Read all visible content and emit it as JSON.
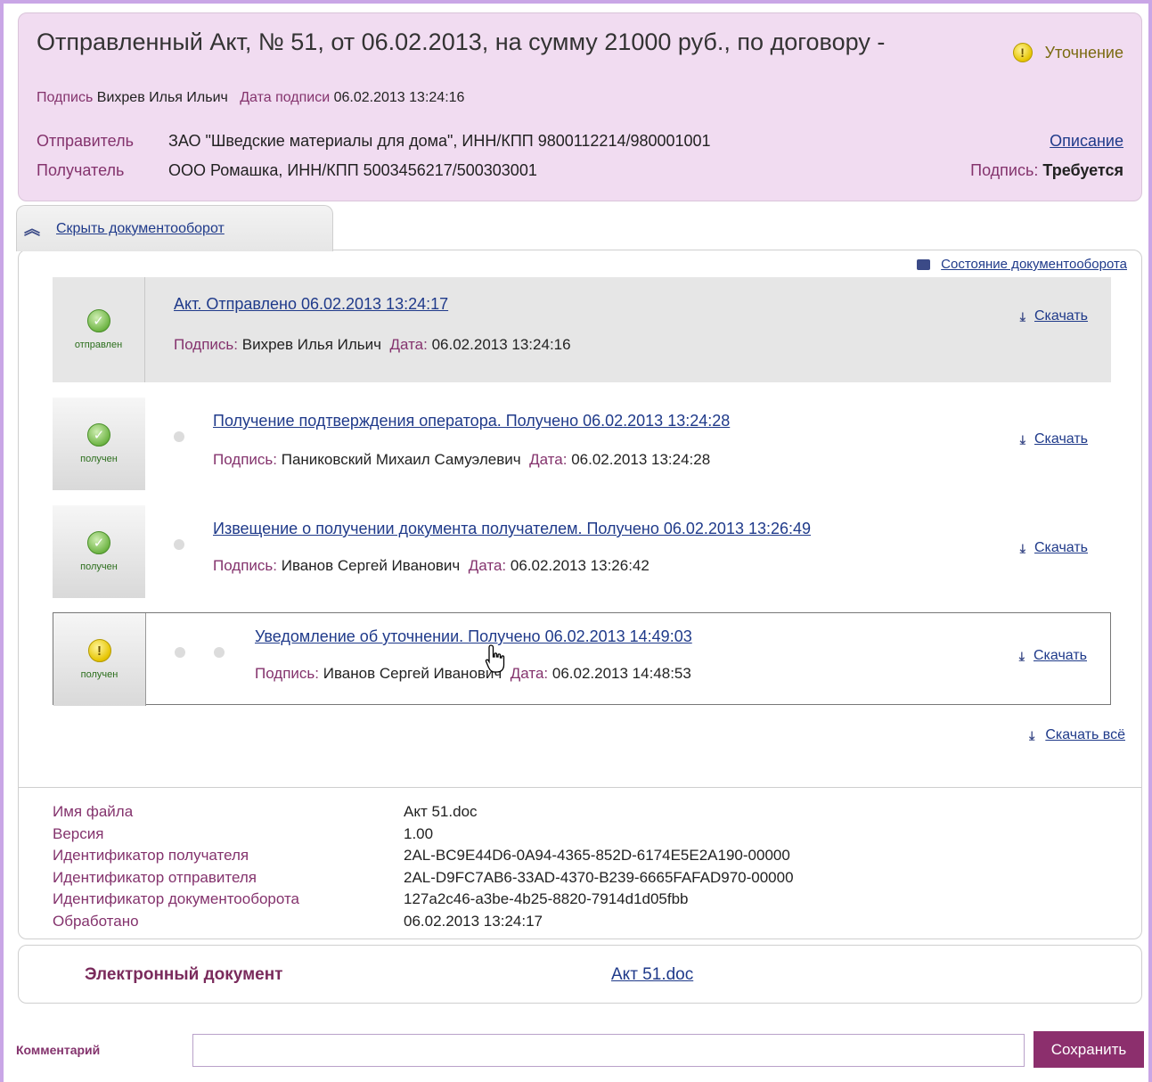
{
  "header": {
    "title": "Отправленный Акт, № 51, от 06.02.2013, на сумму 21000 руб., по договору -",
    "signature_label": "Подпись",
    "signature_value": "Вихрев Илья Ильич",
    "sign_date_label": "Дата подписи",
    "sign_date_value": "06.02.2013 13:24:16",
    "status_text": "Уточнение",
    "sender_label": "Отправитель",
    "sender_value": "ЗАО \"Шведские материалы для дома\", ИНН/КПП 9800112214/980001001",
    "recipient_label": "Получатель",
    "recipient_value": "ООО Ромашка, ИНН/КПП 5003456217/500303001",
    "description_link": "Описание",
    "signature_req_label": "Подпись:",
    "signature_req_value": "Требуется"
  },
  "tab": {
    "label": "Скрыть документооборот"
  },
  "workflow": {
    "state_link": "Состояние документооборота",
    "download_label": "Скачать",
    "download_all_label": "Скачать всё",
    "sig_label": "Подпись:",
    "date_label": "Дата:",
    "items": [
      {
        "status": "отправлен",
        "title": "Акт. Отправлено 06.02.2013 13:24:17",
        "signer": "Вихрев Илья Ильич",
        "date": "06.02.2013 13:24:16",
        "icon": "check-icon"
      },
      {
        "status": "получен",
        "title": "Получение подтверждения оператора. Получено 06.02.2013 13:24:28",
        "signer": "Паниковский Михаил Самуэлевич",
        "date": "06.02.2013 13:24:28",
        "icon": "check-icon"
      },
      {
        "status": "получен",
        "title": "Извещение о получении документа получателем. Получено 06.02.2013 13:26:49",
        "signer": "Иванов Сергей Иванович",
        "date": "06.02.2013 13:26:42",
        "icon": "check-icon"
      },
      {
        "status": "получен",
        "title": "Уведомление об уточнении. Получено 06.02.2013 14:49:03",
        "signer": "Иванов Сергей Иванович",
        "date": "06.02.2013 14:48:53",
        "icon": "warning-icon"
      }
    ]
  },
  "metadata": {
    "rows": [
      {
        "key": "Имя файла",
        "value": "Акт 51.doc"
      },
      {
        "key": "Версия",
        "value": "1.00"
      },
      {
        "key": "Идентификатор получателя",
        "value": "2AL-BC9E44D6-0A94-4365-852D-6174E5E2A190-00000"
      },
      {
        "key": "Идентификатор отправителя",
        "value": "2AL-D9FC7AB6-33AD-4370-B239-6665FAFAD970-00000"
      },
      {
        "key": "Идентификатор документооборота",
        "value": "127a2c46-a3be-4b25-8820-7914d1d05fbb"
      },
      {
        "key": "Обработано",
        "value": "06.02.2013 13:24:17"
      }
    ]
  },
  "edoc": {
    "label": "Электронный документ",
    "value": "Акт 51.doc"
  },
  "comment": {
    "label": "Комментарий",
    "value": "",
    "save_label": "Сохранить"
  },
  "colors": {
    "accent": "#8c2f6d",
    "header_bg": "#f1dcf1",
    "link": "#1f3a8a"
  }
}
